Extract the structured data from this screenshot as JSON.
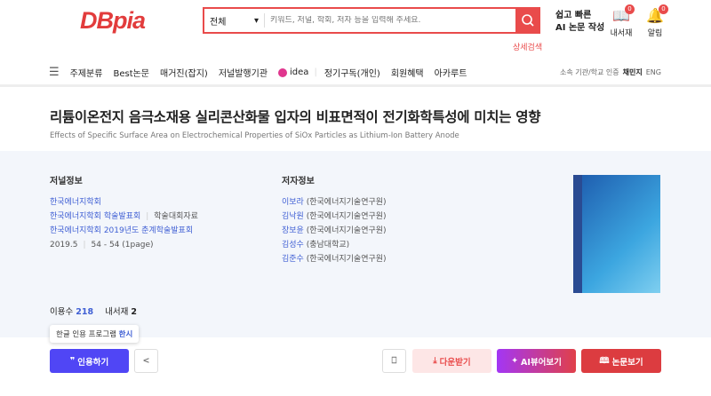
{
  "header": {
    "logo": "DBpia",
    "category": "전체",
    "search_placeholder": "키워드, 저널, 학회, 저자 등을 입력해 주세요.",
    "advanced_search": "상세검색",
    "ai_promo_line1": "쉽고 빠른",
    "ai_promo_line2": "AI 논문 작성",
    "library_label": "내서재",
    "library_count": "0",
    "alerts_label": "알림",
    "alerts_count": "0"
  },
  "nav": {
    "items": [
      "주제분류",
      "Best논문",
      "매거진(잡지)",
      "저널발행기관",
      "idea",
      "정기구독(개인)",
      "회원혜택",
      "아카루트"
    ],
    "right": [
      "소속 기관/학교 인증",
      "채민지",
      "ENG"
    ]
  },
  "paper": {
    "title": "리튬이온전지 음극소재용 실리콘산화물 입자의 비표면적이 전기화학특성에 미치는 영향",
    "subtitle": "Effects of Specific Surface Area on Electrochemical Properties of SiOx Particles as Lithium-Ion Battery Anode"
  },
  "journal": {
    "heading": "저널정보",
    "society": "한국에너지학회",
    "event": "한국에너지학회 학술발표회",
    "event_type": "학술대회자료",
    "proceeding": "한국에너지학회 2019년도 춘계학술발표회",
    "date": "2019.5",
    "pages": "54 - 54 (1page)"
  },
  "authors": {
    "heading": "저자정보",
    "list": [
      {
        "name": "이보라",
        "aff": "(한국에너지기술연구원)"
      },
      {
        "name": "김낙원",
        "aff": "(한국에너지기술연구원)"
      },
      {
        "name": "장보윤",
        "aff": "(한국에너지기술연구원)"
      },
      {
        "name": "김성수",
        "aff": "(충남대학교)"
      },
      {
        "name": "김준수",
        "aff": "(한국에너지기술연구원)"
      }
    ]
  },
  "stats": {
    "usage_label": "이용수",
    "usage": "218",
    "library_label": "내서재",
    "library": "2"
  },
  "actions": {
    "tooltip": "한글 인용 프로그램",
    "tooltip_link": "한시",
    "cite": "인용하기",
    "download": "다운받기",
    "ai_view": "AI뷰어보기",
    "view": "논문보기"
  },
  "colors": {
    "brand": "#e94b4b",
    "cite": "#5046f5",
    "link": "#3f5fd4"
  }
}
